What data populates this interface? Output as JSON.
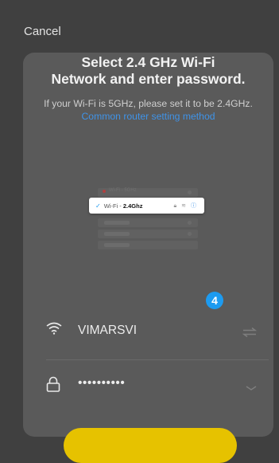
{
  "header": {
    "cancel_label": "Cancel"
  },
  "main": {
    "title_line1": "Select 2.4 GHz Wi-Fi",
    "title_line2": "Network and enter password.",
    "desc_text": "If your Wi-Fi is 5GHz, please set it to be 2.4GHz.",
    "desc_link": "Common router setting method"
  },
  "illustration": {
    "ghost_network_label": "Wi-Fi - 5GHz",
    "network_label": "Wi-Fi - ",
    "network_band": "2.4Ghz"
  },
  "step_badge": "4",
  "form": {
    "ssid": {
      "value": "VIMARSVI",
      "icon": "wifi-icon",
      "action_icon": "switch-network-icon"
    },
    "password": {
      "value": "••••••••••",
      "icon": "lock-icon",
      "action_icon": "chevron-down-icon"
    }
  },
  "colors": {
    "background": "#404040",
    "card": "#5a5a5a",
    "link": "#3f93e8",
    "badge": "#1d9bf0",
    "cta": "#e6c200"
  }
}
